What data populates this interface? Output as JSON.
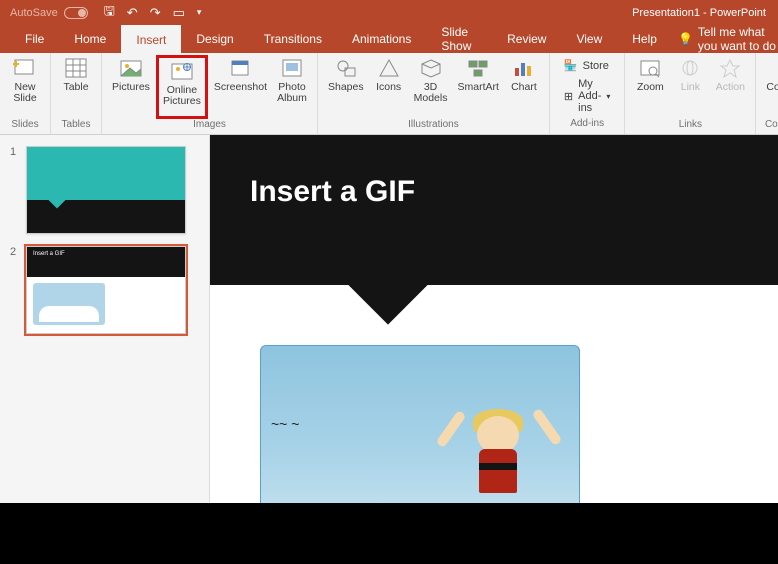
{
  "title": {
    "autosave_label": "AutoSave",
    "app_title": "Presentation1 - PowerPoint"
  },
  "tabs": {
    "file": "File",
    "home": "Home",
    "insert": "Insert",
    "design": "Design",
    "transitions": "Transitions",
    "animations": "Animations",
    "slideshow": "Slide Show",
    "review": "Review",
    "view": "View",
    "help": "Help",
    "tell_me": "Tell me what you want to do"
  },
  "ribbon": {
    "groups": {
      "slides": {
        "label": "Slides",
        "new_slide": "New\nSlide"
      },
      "tables": {
        "label": "Tables",
        "table": "Table"
      },
      "images": {
        "label": "Images",
        "pictures": "Pictures",
        "online_pictures": "Online\nPictures",
        "screenshot": "Screenshot",
        "photo_album": "Photo\nAlbum"
      },
      "illustrations": {
        "label": "Illustrations",
        "shapes": "Shapes",
        "icons": "Icons",
        "models": "3D\nModels",
        "smartart": "SmartArt",
        "chart": "Chart"
      },
      "addins": {
        "label": "Add-ins",
        "store": "Store",
        "my_addins": "My Add-ins"
      },
      "links": {
        "label": "Links",
        "zoom": "Zoom",
        "link": "Link",
        "action": "Action"
      },
      "comments": {
        "label": "Comments",
        "comment": "Comment"
      }
    }
  },
  "thumbnails": [
    {
      "index": "1"
    },
    {
      "index": "2",
      "title": "Insert a GIF"
    }
  ],
  "slide": {
    "title": "Insert a GIF"
  }
}
